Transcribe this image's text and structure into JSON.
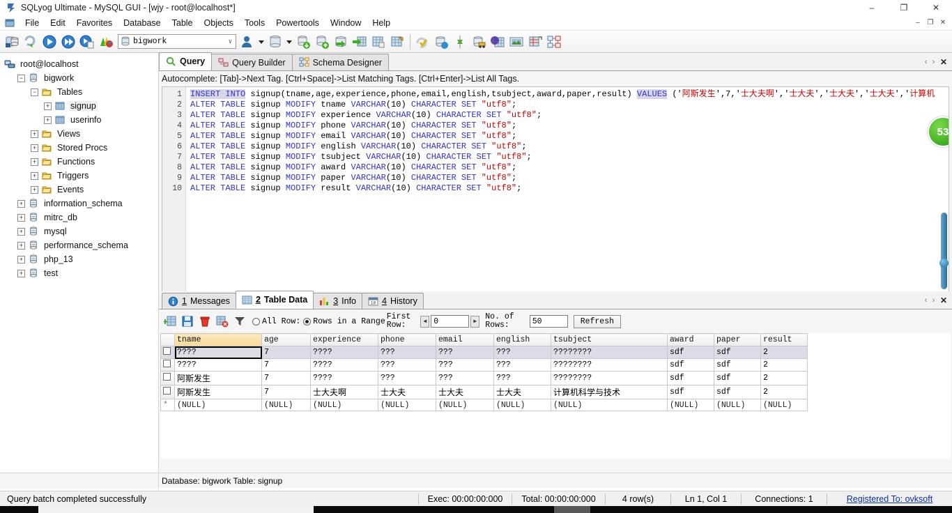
{
  "window": {
    "title": "SQLyog Ultimate - MySQL GUI - [wjy - root@localhost*]",
    "app_icon": "sqlyog-icon",
    "minimize": "–",
    "maximize": "❐",
    "close": "✕",
    "mdi_minimize": "–",
    "mdi_restore": "❐",
    "mdi_close": "✕"
  },
  "menu": {
    "items": [
      {
        "label": "File"
      },
      {
        "label": "Edit"
      },
      {
        "label": "Favorites"
      },
      {
        "label": "Database"
      },
      {
        "label": "Table"
      },
      {
        "label": "Objects"
      },
      {
        "label": "Tools"
      },
      {
        "label": "Powertools"
      },
      {
        "label": "Window"
      },
      {
        "label": "Help"
      }
    ]
  },
  "toolbar": {
    "database_combo_value": "bigwork",
    "combo_arrow": "∨",
    "icons": [
      {
        "name": "new-connection-icon"
      },
      {
        "name": "refresh-object-browser-icon"
      },
      {
        "name": "execute-query-icon"
      },
      {
        "name": "execute-all-queries-icon"
      },
      {
        "name": "execute-query-and-export-icon"
      },
      {
        "name": "stop-execution-icon"
      },
      {
        "name": "user-manager-icon"
      },
      {
        "name": "database-dropdown-icon"
      },
      {
        "name": "backup-database-icon"
      },
      {
        "name": "restore-database-icon"
      },
      {
        "name": "import-external-data-icon"
      },
      {
        "name": "export-table-data-icon"
      },
      {
        "name": "table-diagnostics-icon"
      },
      {
        "name": "manage-indexes-icon"
      },
      {
        "name": "sql-formatter-icon"
      },
      {
        "name": "query-builder-icon"
      },
      {
        "name": "sync-database-icon"
      },
      {
        "name": "data-transfer-icon"
      },
      {
        "name": "copy-database-icon"
      },
      {
        "name": "notes-icon"
      },
      {
        "name": "schema-designer-icon"
      },
      {
        "name": "scheduler-icon"
      }
    ]
  },
  "object_browser": {
    "root": {
      "label": "root@localhost",
      "icon": "host-icon"
    },
    "nodes": [
      {
        "label": "bigwork",
        "icon": "database-icon",
        "expander": "−",
        "indent": 1
      },
      {
        "label": "Tables",
        "icon": "folder-icon",
        "expander": "−",
        "indent": 2
      },
      {
        "label": "signup",
        "icon": "table-icon",
        "expander": "+",
        "indent": 3,
        "selected": true
      },
      {
        "label": "userinfo",
        "icon": "table-icon",
        "expander": "+",
        "indent": 3
      },
      {
        "label": "Views",
        "icon": "folder-icon",
        "expander": "+",
        "indent": 2
      },
      {
        "label": "Stored Procs",
        "icon": "folder-icon",
        "expander": "+",
        "indent": 2
      },
      {
        "label": "Functions",
        "icon": "folder-icon",
        "expander": "+",
        "indent": 2
      },
      {
        "label": "Triggers",
        "icon": "folder-icon",
        "expander": "+",
        "indent": 2
      },
      {
        "label": "Events",
        "icon": "folder-icon",
        "expander": "+",
        "indent": 2
      },
      {
        "label": "information_schema",
        "icon": "database-icon",
        "expander": "+",
        "indent": 1
      },
      {
        "label": "mitrc_db",
        "icon": "database-icon",
        "expander": "+",
        "indent": 1
      },
      {
        "label": "mysql",
        "icon": "database-icon",
        "expander": "+",
        "indent": 1
      },
      {
        "label": "performance_schema",
        "icon": "database-icon",
        "expander": "+",
        "indent": 1
      },
      {
        "label": "php_13",
        "icon": "database-icon",
        "expander": "+",
        "indent": 1
      },
      {
        "label": "test",
        "icon": "database-icon",
        "expander": "+",
        "indent": 1
      }
    ]
  },
  "editor_tabs": {
    "tabs": [
      {
        "label": "Query",
        "icon": "query-icon",
        "active": true
      },
      {
        "label": "Query Builder",
        "icon": "query-builder-icon",
        "active": false
      },
      {
        "label": "Schema Designer",
        "icon": "schema-designer-icon",
        "active": false
      }
    ],
    "nav_left": "‹",
    "nav_right": "›",
    "close": "✕"
  },
  "autocomplete_hint": "Autocomplete: [Tab]->Next Tag. [Ctrl+Space]->List Matching Tags. [Ctrl+Enter]->List All Tags.",
  "sql": {
    "line_numbers": [
      "1",
      "2",
      "3",
      "4",
      "5",
      "6",
      "7",
      "8",
      "9",
      "10"
    ],
    "lines": [
      {
        "n": 1,
        "tokens": [
          {
            "t": "INSERT INTO",
            "c": "kwhi"
          },
          {
            "t": " signup(tname,age,experience,phone,email,english,tsubject,award,paper,result) ",
            "c": "plain"
          },
          {
            "t": "VALUES",
            "c": "kwhi"
          },
          {
            "t": " ('",
            "c": "plain"
          },
          {
            "t": "阿斯发生",
            "c": "str"
          },
          {
            "t": "',7,'",
            "c": "plain"
          },
          {
            "t": "士大夫啊",
            "c": "str"
          },
          {
            "t": "','",
            "c": "plain"
          },
          {
            "t": "士大夫",
            "c": "str"
          },
          {
            "t": "','",
            "c": "plain"
          },
          {
            "t": "士大夫",
            "c": "str"
          },
          {
            "t": "','",
            "c": "plain"
          },
          {
            "t": "士大夫",
            "c": "str"
          },
          {
            "t": "','",
            "c": "plain"
          },
          {
            "t": "计算机",
            "c": "str"
          }
        ]
      },
      {
        "n": 2,
        "tokens": [
          {
            "t": "ALTER TABLE",
            "c": "kw"
          },
          {
            "t": " signup ",
            "c": "plain"
          },
          {
            "t": "MODIFY",
            "c": "kw"
          },
          {
            "t": " tname ",
            "c": "plain"
          },
          {
            "t": "VARCHAR",
            "c": "kw"
          },
          {
            "t": "(10) ",
            "c": "plain"
          },
          {
            "t": "CHARACTER SET",
            "c": "kw"
          },
          {
            "t": " ",
            "c": "plain"
          },
          {
            "t": "\"utf8\"",
            "c": "str"
          },
          {
            "t": ";",
            "c": "plain"
          }
        ]
      },
      {
        "n": 3,
        "tokens": [
          {
            "t": "ALTER TABLE",
            "c": "kw"
          },
          {
            "t": " signup ",
            "c": "plain"
          },
          {
            "t": "MODIFY",
            "c": "kw"
          },
          {
            "t": " experience ",
            "c": "plain"
          },
          {
            "t": "VARCHAR",
            "c": "kw"
          },
          {
            "t": "(10) ",
            "c": "plain"
          },
          {
            "t": "CHARACTER SET",
            "c": "kw"
          },
          {
            "t": " ",
            "c": "plain"
          },
          {
            "t": "\"utf8\"",
            "c": "str"
          },
          {
            "t": ";",
            "c": "plain"
          }
        ]
      },
      {
        "n": 4,
        "tokens": [
          {
            "t": "ALTER TABLE",
            "c": "kw"
          },
          {
            "t": " signup ",
            "c": "plain"
          },
          {
            "t": "MODIFY",
            "c": "kw"
          },
          {
            "t": " phone ",
            "c": "plain"
          },
          {
            "t": "VARCHAR",
            "c": "kw"
          },
          {
            "t": "(10) ",
            "c": "plain"
          },
          {
            "t": "CHARACTER SET",
            "c": "kw"
          },
          {
            "t": " ",
            "c": "plain"
          },
          {
            "t": "\"utf8\"",
            "c": "str"
          },
          {
            "t": ";",
            "c": "plain"
          }
        ]
      },
      {
        "n": 5,
        "tokens": [
          {
            "t": "ALTER TABLE",
            "c": "kw"
          },
          {
            "t": " signup ",
            "c": "plain"
          },
          {
            "t": "MODIFY",
            "c": "kw"
          },
          {
            "t": " email ",
            "c": "plain"
          },
          {
            "t": "VARCHAR",
            "c": "kw"
          },
          {
            "t": "(10) ",
            "c": "plain"
          },
          {
            "t": "CHARACTER SET",
            "c": "kw"
          },
          {
            "t": " ",
            "c": "plain"
          },
          {
            "t": "\"utf8\"",
            "c": "str"
          },
          {
            "t": ";",
            "c": "plain"
          }
        ]
      },
      {
        "n": 6,
        "tokens": [
          {
            "t": "ALTER TABLE",
            "c": "kw"
          },
          {
            "t": " signup ",
            "c": "plain"
          },
          {
            "t": "MODIFY",
            "c": "kw"
          },
          {
            "t": " english ",
            "c": "plain"
          },
          {
            "t": "VARCHAR",
            "c": "kw"
          },
          {
            "t": "(10) ",
            "c": "plain"
          },
          {
            "t": "CHARACTER SET",
            "c": "kw"
          },
          {
            "t": " ",
            "c": "plain"
          },
          {
            "t": "\"utf8\"",
            "c": "str"
          },
          {
            "t": ";",
            "c": "plain"
          }
        ]
      },
      {
        "n": 7,
        "tokens": [
          {
            "t": "ALTER TABLE",
            "c": "kw"
          },
          {
            "t": " signup ",
            "c": "plain"
          },
          {
            "t": "MODIFY",
            "c": "kw"
          },
          {
            "t": " tsubject ",
            "c": "plain"
          },
          {
            "t": "VARCHAR",
            "c": "kw"
          },
          {
            "t": "(10) ",
            "c": "plain"
          },
          {
            "t": "CHARACTER SET",
            "c": "kw"
          },
          {
            "t": " ",
            "c": "plain"
          },
          {
            "t": "\"utf8\"",
            "c": "str"
          },
          {
            "t": ";",
            "c": "plain"
          }
        ]
      },
      {
        "n": 8,
        "tokens": [
          {
            "t": "ALTER TABLE",
            "c": "kw"
          },
          {
            "t": " signup ",
            "c": "plain"
          },
          {
            "t": "MODIFY",
            "c": "kw"
          },
          {
            "t": " award ",
            "c": "plain"
          },
          {
            "t": "VARCHAR",
            "c": "kw"
          },
          {
            "t": "(10) ",
            "c": "plain"
          },
          {
            "t": "CHARACTER SET",
            "c": "kw"
          },
          {
            "t": " ",
            "c": "plain"
          },
          {
            "t": "\"utf8\"",
            "c": "str"
          },
          {
            "t": ";",
            "c": "plain"
          }
        ]
      },
      {
        "n": 9,
        "tokens": [
          {
            "t": "ALTER TABLE",
            "c": "kw"
          },
          {
            "t": " signup ",
            "c": "plain"
          },
          {
            "t": "MODIFY",
            "c": "kw"
          },
          {
            "t": " paper ",
            "c": "plain"
          },
          {
            "t": "VARCHAR",
            "c": "kw"
          },
          {
            "t": "(10) ",
            "c": "plain"
          },
          {
            "t": "CHARACTER SET",
            "c": "kw"
          },
          {
            "t": " ",
            "c": "plain"
          },
          {
            "t": "\"utf8\"",
            "c": "str"
          },
          {
            "t": ";",
            "c": "plain"
          }
        ]
      },
      {
        "n": 10,
        "tokens": [
          {
            "t": "ALTER TABLE",
            "c": "kw"
          },
          {
            "t": " signup ",
            "c": "plain"
          },
          {
            "t": "MODIFY",
            "c": "kw"
          },
          {
            "t": " result ",
            "c": "plain"
          },
          {
            "t": "VARCHAR",
            "c": "kw"
          },
          {
            "t": "(10) ",
            "c": "plain"
          },
          {
            "t": "CHARACTER SET",
            "c": "kw"
          },
          {
            "t": " ",
            "c": "plain"
          },
          {
            "t": "\"utf8\"",
            "c": "str"
          },
          {
            "t": ";",
            "c": "plain"
          }
        ]
      }
    ],
    "badge_text": "53",
    "scroll_left_arrow": "‹",
    "scroll_right_arrow": "›"
  },
  "result_tabs": {
    "tabs": [
      {
        "num": "1",
        "label": "Messages",
        "icon": "messages-icon",
        "active": false
      },
      {
        "num": "2",
        "label": "Table Data",
        "icon": "table-data-icon",
        "active": true
      },
      {
        "num": "3",
        "label": "Info",
        "icon": "info-icon",
        "active": false
      },
      {
        "num": "4",
        "label": "History",
        "icon": "history-icon",
        "active": false
      }
    ],
    "nav_left": "‹",
    "nav_right": "›",
    "close": "✕"
  },
  "grid_toolbar": {
    "icons": [
      {
        "name": "insert-row-icon"
      },
      {
        "name": "save-changes-icon"
      },
      {
        "name": "delete-row-icon"
      },
      {
        "name": "refresh-data-icon"
      },
      {
        "name": "filter-icon"
      }
    ],
    "all_rows_label": "All Row:",
    "range_rows_label": "Rows in a Range",
    "first_row_label_1": "First",
    "first_row_label_2": "Row:",
    "first_row_value": "0",
    "no_of_rows_label_1": "No. of",
    "no_of_rows_label_2": "Rows:",
    "no_of_rows_value": "50",
    "refresh_label": "Refresh",
    "spin_left": "◀",
    "spin_right": "▶",
    "selected_mode": "range"
  },
  "data_grid": {
    "columns": [
      "tname",
      "age",
      "experience",
      "phone",
      "email",
      "english",
      "tsubject",
      "award",
      "paper",
      "result"
    ],
    "key_column": "tname",
    "rows": [
      {
        "selected": true,
        "cells": [
          "????",
          "7",
          "????",
          "???",
          "???",
          "???",
          "????????",
          "sdf",
          "sdf",
          "2"
        ],
        "cjk": [
          false,
          false,
          false,
          false,
          false,
          false,
          false,
          false,
          false,
          false
        ]
      },
      {
        "selected": false,
        "cells": [
          "????",
          "7",
          "????",
          "???",
          "???",
          "???",
          "????????",
          "sdf",
          "sdf",
          "2"
        ],
        "cjk": [
          false,
          false,
          false,
          false,
          false,
          false,
          false,
          false,
          false,
          false
        ]
      },
      {
        "selected": false,
        "cells": [
          "阿斯发生",
          "7",
          "????",
          "???",
          "???",
          "???",
          "????????",
          "sdf",
          "sdf",
          "2"
        ],
        "cjk": [
          true,
          false,
          false,
          false,
          false,
          false,
          false,
          false,
          false,
          false
        ]
      },
      {
        "selected": false,
        "cells": [
          "阿斯发生",
          "7",
          "士大夫啊",
          "士大夫",
          "士大夫",
          "士大夫",
          "计算机科学与技术",
          "sdf",
          "sdf",
          "2"
        ],
        "cjk": [
          true,
          false,
          true,
          true,
          true,
          true,
          true,
          false,
          false,
          false
        ]
      }
    ],
    "new_row": {
      "marker": "*",
      "cells": [
        "(NULL)",
        "(NULL)",
        "(NULL)",
        "(NULL)",
        "(NULL)",
        "(NULL)",
        "(NULL)",
        "(NULL)",
        "(NULL)",
        "(NULL)"
      ]
    }
  },
  "db_status": "Database: bigwork Table: signup",
  "statusbar": {
    "message": "Query batch completed successfully",
    "exec": "Exec: 00:00:00:000",
    "total": "Total: 00:00:00:000",
    "rows": "4 row(s)",
    "caret": "Ln 1, Col 1",
    "connections": "Connections: 1",
    "registered": "Registered To: ovksoft"
  },
  "colors": {
    "keyword": "#3333cc",
    "string": "#cc0000",
    "key_column_header": "#f7d99a",
    "selection": "#dcdce8",
    "link": "#0a2fa8",
    "badge_green": "#3fae22"
  }
}
